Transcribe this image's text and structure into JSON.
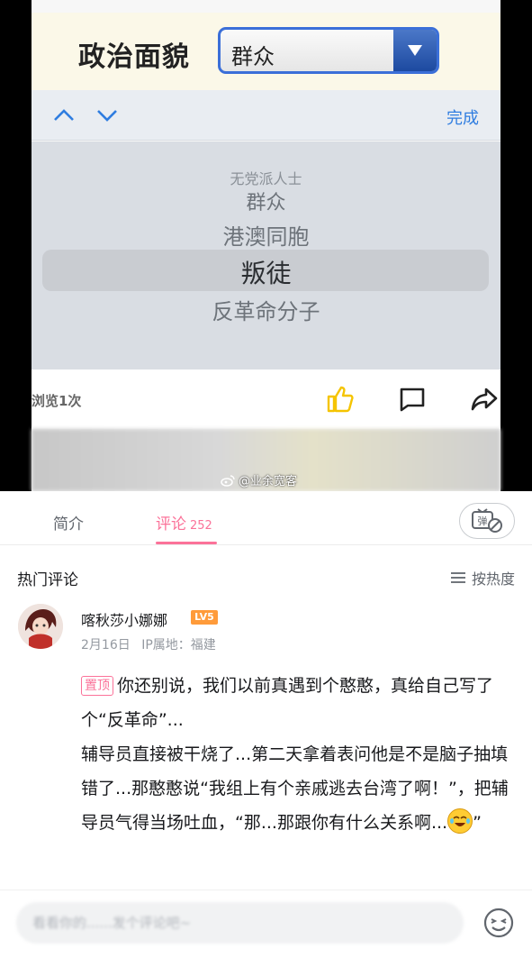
{
  "embedded": {
    "form_label": "政治面貌",
    "select_value": "群众",
    "done_label": "完成",
    "wheel_items": [
      "无党派人士",
      "群众",
      "港澳同胞",
      "叛徒",
      "反革命分子"
    ],
    "views": "浏览1次",
    "watermark": "@业余宽客"
  },
  "tabs": {
    "intro": "简介",
    "comments": "评论",
    "comments_count": "252"
  },
  "comments_header": {
    "title": "热门评论",
    "sort_label": "按热度"
  },
  "comment": {
    "username": "喀秋莎小娜娜",
    "level": "LV5",
    "date": "2月16日",
    "ip": "IP属地：福建",
    "pin_label": "置顶",
    "text_1": "你还别说，我们以前真遇到个憨憨，真给自己写了个“反革命”...",
    "text_2": "辅导员直接被干烧了...第二天拿着表问他是不是脑子抽填错了...那憨憨说“我组上有个亲戚逃去台湾了啊！”，把辅导员气得当场吐血，“那...那跟你有什么关系啊...",
    "text_3": "”"
  },
  "input": {
    "placeholder": "看看你的......发个评论吧~"
  },
  "colors": {
    "accent": "#fb7299",
    "link_blue": "#2f7de0",
    "like_yellow": "#f5c400"
  }
}
